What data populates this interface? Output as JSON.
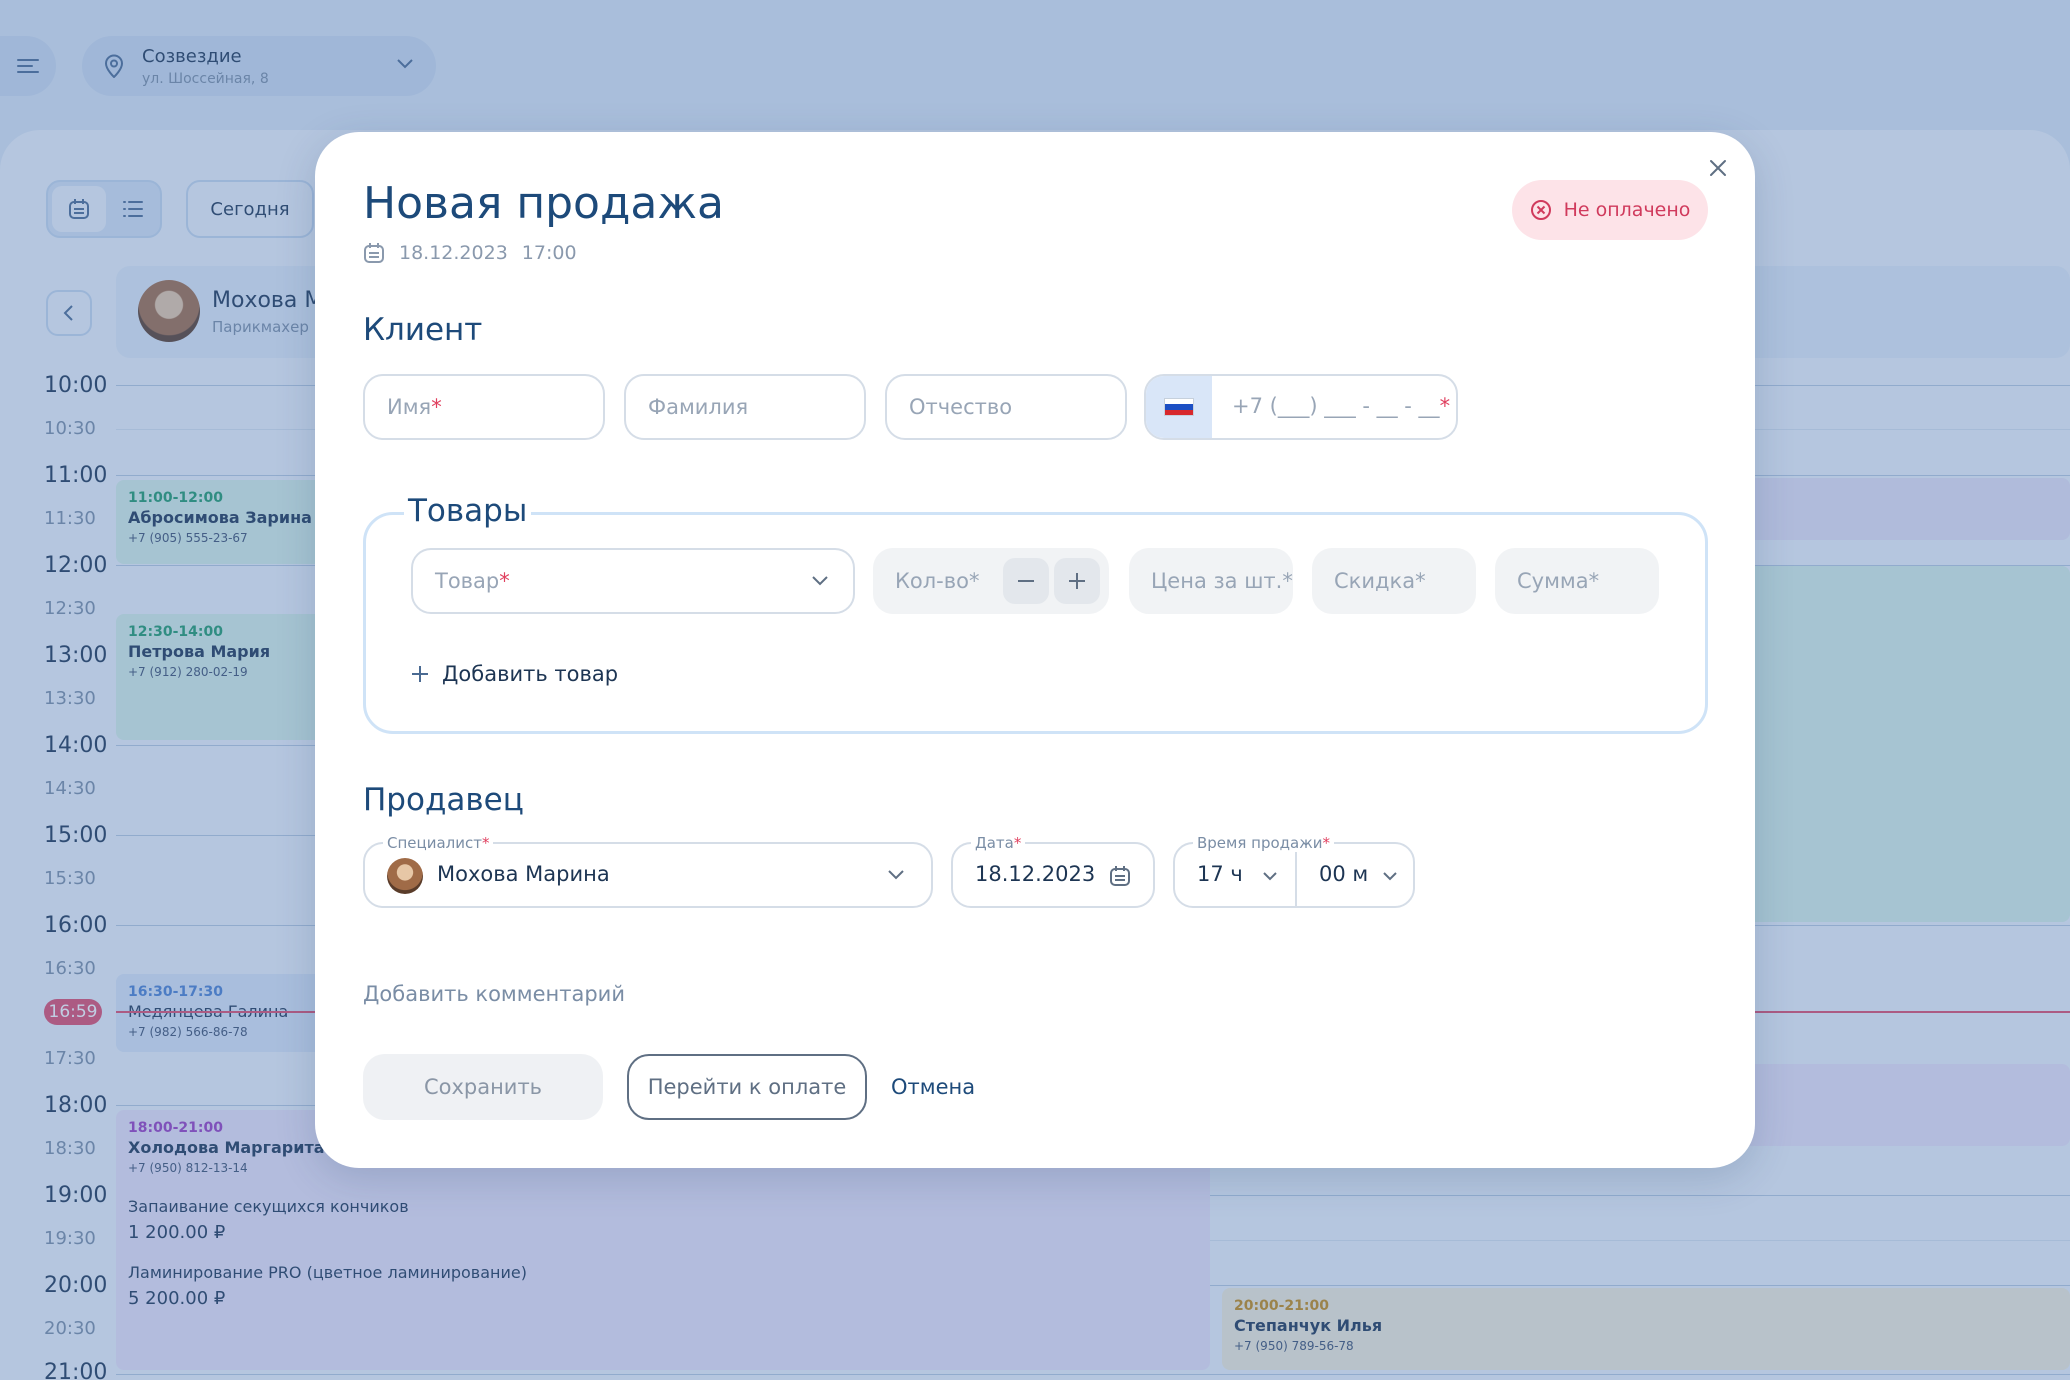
{
  "location": {
    "name": "Созвездие",
    "address": "ул. Шоссейная, 8"
  },
  "toolbar": {
    "today_label": "Сегодня"
  },
  "staff": {
    "name": "Мохова М",
    "role": "Парикмахер"
  },
  "time_labels": [
    "10:00",
    "10:30",
    "11:00",
    "11:30",
    "12:00",
    "12:30",
    "13:00",
    "13:30",
    "14:00",
    "14:30",
    "15:00",
    "15:30",
    "16:00",
    "16:30",
    "17:30",
    "18:00",
    "18:30",
    "19:00",
    "19:30",
    "20:00",
    "20:30",
    "21:00"
  ],
  "now_badge": "16:59",
  "appointments": [
    {
      "time": "11:00-12:00",
      "name": "Абросимова Зарина",
      "phone": "+7 (905) 555-23-67",
      "color": "#3aa27a"
    },
    {
      "time": "12:30-14:00",
      "name": "Петрова Мария",
      "phone": "+7 (912) 280-02-19",
      "color": "#3aa27a"
    },
    {
      "time": "16:30-17:30",
      "name": "Медянцева Галина",
      "phone": "+7 (982) 566-86-78",
      "color": "#4a7fd0"
    },
    {
      "time": "18:00-21:00",
      "name": "Холодова Маргарита",
      "phone": "+7 (950) 812-13-14",
      "color": "#9a3cc0",
      "services": [
        {
          "name": "Запаивание секущихся кончиков",
          "price": "1 200.00 ₽"
        },
        {
          "name": "Ламинирование PRO (цветное ламинирование)",
          "price": "5 200.00 ₽"
        }
      ]
    },
    {
      "time": "20:00-21:00",
      "name": "Степанчук Илья",
      "phone": "+7 (950) 789-56-78",
      "color": "#d09a2a"
    }
  ],
  "modal": {
    "title": "Новая продажа",
    "date": "18.12.2023",
    "time": "17:00",
    "status": "Не оплачено",
    "client": {
      "title": "Клиент",
      "first_name_placeholder": "Имя",
      "last_name_placeholder": "Фамилия",
      "middle_name_placeholder": "Отчество",
      "phone_placeholder": "+7 (___) ___ - __ - __"
    },
    "goods": {
      "title": "Товары",
      "product_placeholder": "Товар",
      "qty_placeholder": "Кол-во*",
      "price_placeholder": "Цена за шт.*",
      "discount_placeholder": "Скидка*",
      "sum_placeholder": "Сумма*",
      "add_label": "Добавить товар"
    },
    "seller": {
      "title": "Продавец",
      "specialist_label": "Специалист",
      "specialist_value": "Мохова Марина",
      "date_label": "Дата",
      "date_value": "18.12.2023",
      "time_label": "Время продажи",
      "hour_value": "17 ч",
      "minute_value": "00 м"
    },
    "comment_link": "Добавить комментарий",
    "buttons": {
      "save": "Сохранить",
      "pay": "Перейти к оплате",
      "cancel": "Отмена"
    }
  },
  "colors": {
    "accent": "#1d4a7a",
    "required": "#e0405f",
    "unpaid_bg": "#fde3e8",
    "unpaid_text": "#d03a5c",
    "now_line": "#e04b6b"
  }
}
